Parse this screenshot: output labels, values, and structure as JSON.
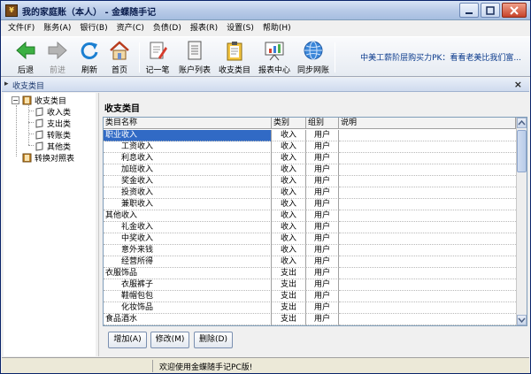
{
  "window": {
    "title": "我的家庭账（本人） - 金蝶随手记",
    "icon": "app-logo-icon"
  },
  "menu": [
    "文件(F)",
    "账务(A)",
    "银行(B)",
    "资产(C)",
    "负债(D)",
    "报表(R)",
    "设置(S)",
    "帮助(H)"
  ],
  "toolbar": {
    "buttons": [
      {
        "label": "后退",
        "icon": "back-arrow-icon",
        "enabled": true
      },
      {
        "label": "前进",
        "icon": "forward-arrow-icon",
        "enabled": false
      },
      {
        "label": "刷新",
        "icon": "refresh-icon",
        "enabled": true
      },
      {
        "label": "首页",
        "icon": "home-icon",
        "enabled": true
      },
      {
        "label": "记一笔",
        "icon": "pen-note-icon",
        "enabled": true
      },
      {
        "label": "账户列表",
        "icon": "account-list-icon",
        "enabled": true
      },
      {
        "label": "收支类目",
        "icon": "clipboard-icon",
        "enabled": true
      },
      {
        "label": "报表中心",
        "icon": "chart-board-icon",
        "enabled": true
      },
      {
        "label": "同步网账",
        "icon": "globe-sync-icon",
        "enabled": true
      }
    ],
    "marquee": "中美工薪阶层购买力PK：看看老美比我们富..."
  },
  "panel": {
    "title": "收支类目"
  },
  "tree": {
    "root": "收支类目",
    "children": [
      "收入类",
      "支出类",
      "转账类",
      "其他类"
    ],
    "second_root": "转换对照表"
  },
  "main": {
    "title": "收支类目",
    "columns": [
      "类目名称",
      "类别",
      "组别",
      "说明"
    ],
    "rows": [
      {
        "name": "职业收入",
        "type": "收入",
        "group": "用户",
        "note": "",
        "child": false,
        "selected": true
      },
      {
        "name": "工资收入",
        "type": "收入",
        "group": "用户",
        "note": "",
        "child": true
      },
      {
        "name": "利息收入",
        "type": "收入",
        "group": "用户",
        "note": "",
        "child": true
      },
      {
        "name": "加班收入",
        "type": "收入",
        "group": "用户",
        "note": "",
        "child": true
      },
      {
        "name": "奖金收入",
        "type": "收入",
        "group": "用户",
        "note": "",
        "child": true
      },
      {
        "name": "投资收入",
        "type": "收入",
        "group": "用户",
        "note": "",
        "child": true
      },
      {
        "name": "兼职收入",
        "type": "收入",
        "group": "用户",
        "note": "",
        "child": true
      },
      {
        "name": "其他收入",
        "type": "收入",
        "group": "用户",
        "note": "",
        "child": false
      },
      {
        "name": "礼金收入",
        "type": "收入",
        "group": "用户",
        "note": "",
        "child": true
      },
      {
        "name": "中奖收入",
        "type": "收入",
        "group": "用户",
        "note": "",
        "child": true
      },
      {
        "name": "意外来钱",
        "type": "收入",
        "group": "用户",
        "note": "",
        "child": true
      },
      {
        "name": "经营所得",
        "type": "收入",
        "group": "用户",
        "note": "",
        "child": true
      },
      {
        "name": "衣服饰品",
        "type": "支出",
        "group": "用户",
        "note": "",
        "child": false
      },
      {
        "name": "衣服裤子",
        "type": "支出",
        "group": "用户",
        "note": "",
        "child": true
      },
      {
        "name": "鞋帽包包",
        "type": "支出",
        "group": "用户",
        "note": "",
        "child": true
      },
      {
        "name": "化妆饰品",
        "type": "支出",
        "group": "用户",
        "note": "",
        "child": true
      },
      {
        "name": "食品酒水",
        "type": "支出",
        "group": "用户",
        "note": "",
        "child": false
      }
    ],
    "buttons": [
      "增加(A)",
      "修改(M)",
      "删除(D)"
    ]
  },
  "status": {
    "text": "欢迎使用金蝶随手记PC版!"
  },
  "colors": {
    "selection": "#316ac5",
    "title_gradient_top": "#d7e3f5",
    "marquee_text": "#0a3a8c"
  }
}
